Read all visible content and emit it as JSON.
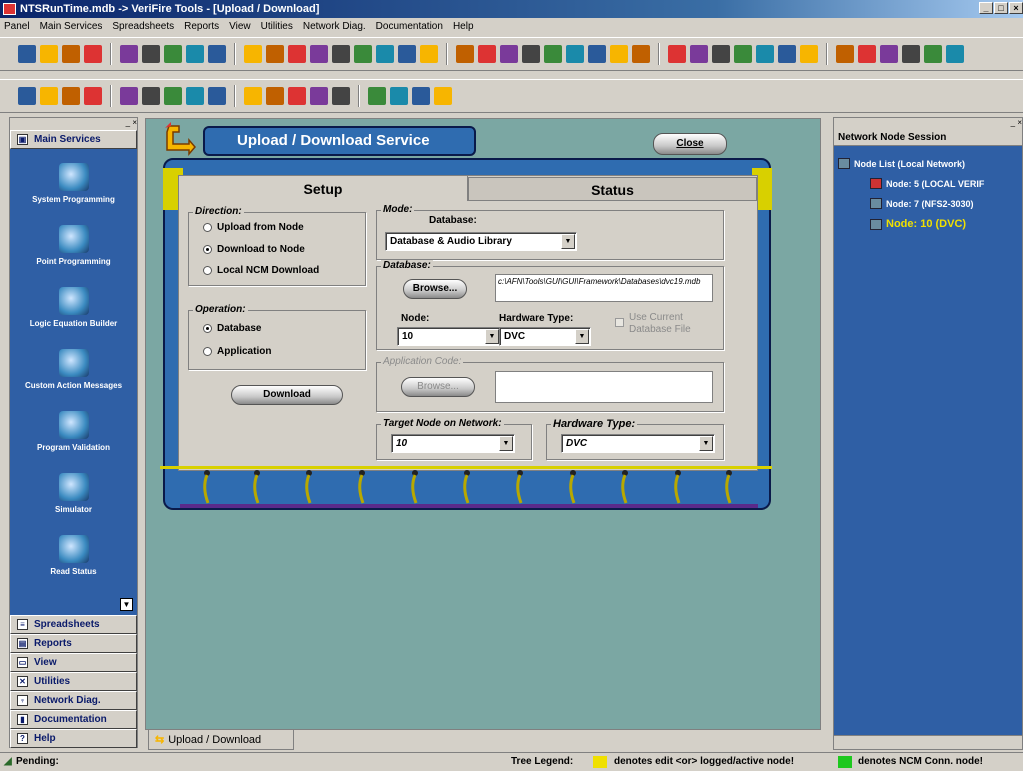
{
  "window": {
    "title": "NTSRunTime.mdb  ->  VeriFire Tools - [Upload / Download]",
    "buttons": [
      "_",
      "□",
      "×"
    ]
  },
  "menubar": [
    "Panel",
    "Main Services",
    "Spreadsheets",
    "Reports",
    "View",
    "Utilities",
    "Network Diag.",
    "Documentation",
    "Help"
  ],
  "left_pane": {
    "main_services": "Main Services",
    "services": [
      "System Programming",
      "Point Programming",
      "Logic Equation Builder",
      "Custom Action Messages",
      "Program Validation",
      "Simulator",
      "Read Status"
    ],
    "categories": [
      "Spreadsheets",
      "Reports",
      "View",
      "Utilities",
      "Network Diag.",
      "Documentation",
      "Help"
    ]
  },
  "dialog": {
    "title": "Upload / Download Service",
    "close": "Close",
    "tabs": {
      "setup": "Setup",
      "status": "Status"
    },
    "direction": {
      "legend": "Direction:",
      "options": [
        "Upload from Node",
        "Download to Node",
        "Local NCM Download"
      ],
      "selected": "Download to Node"
    },
    "operation": {
      "legend": "Operation:",
      "options": [
        "Database",
        "Application"
      ],
      "selected": "Database"
    },
    "download_button": "Download",
    "mode": {
      "legend": "Mode:",
      "db_label": "Database:",
      "value": "Database & Audio Library"
    },
    "database": {
      "legend": "Database:",
      "browse": "Browse...",
      "path": "c:\\AFN\\Tools\\GUI\\GUI\\Framework\\Databases\\dvc19.mdb",
      "node_label": "Node:",
      "node_value": "10",
      "hw_label": "Hardware Type:",
      "hw_value": "DVC",
      "use_current": "Use Current Database File"
    },
    "application": {
      "legend": "Application Code:",
      "browse": "Browse..."
    },
    "target": {
      "legend": "Target Node on Network:",
      "value": "10"
    },
    "hardware": {
      "legend": "Hardware Type:",
      "value": "DVC"
    }
  },
  "window_tab": "Upload / Download",
  "right_pane": {
    "title": "Network Node Session",
    "root": "Node List (Local Network)",
    "nodes": [
      "Node: 5 (LOCAL VERIF",
      "Node: 7 (NFS2-3030)",
      "Node: 10 (DVC)"
    ]
  },
  "status": {
    "pending": "Pending:",
    "legend_label": "Tree Legend:",
    "legend1": "denotes edit <or> logged/active node!",
    "legend2": "denotes NCM Conn. node!"
  },
  "colors": {
    "work": "#7ba7a3",
    "panel_blue": "#2f5fa5",
    "dialog_blue": "#2f6cb0",
    "yellow": "#d8d000",
    "active_node": "#f0e000",
    "green": "#1ec81e"
  }
}
